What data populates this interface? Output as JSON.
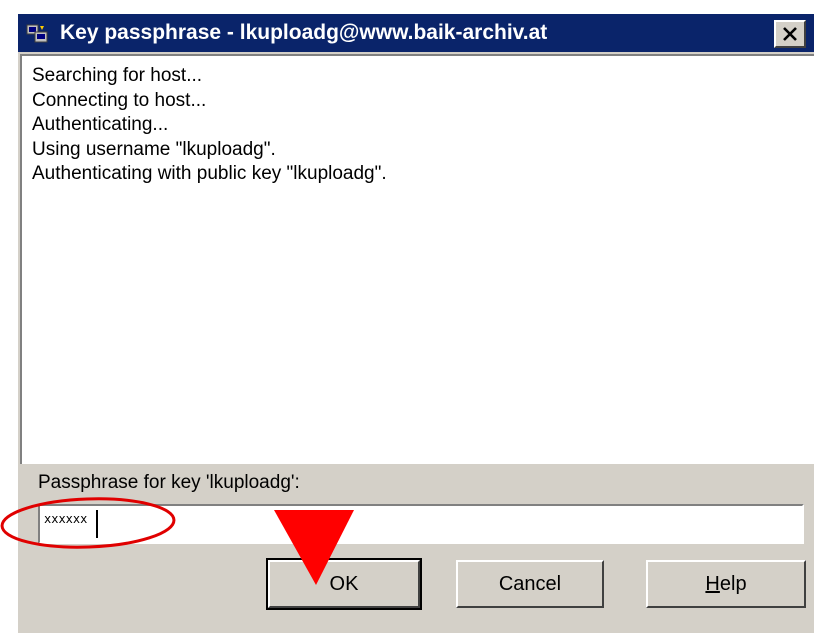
{
  "window": {
    "title": "Key passphrase - lkuploadg@www.baik-archiv.at",
    "close_label": "×"
  },
  "log": {
    "lines": [
      "Searching for host...",
      "Connecting to host...",
      "Authenticating...",
      "Using username \"lkuploadg\".",
      "Authenticating with public key \"lkuploadg\"."
    ]
  },
  "passphrase": {
    "label": "Passphrase for key 'lkuploadg':",
    "value": "xxxxxx"
  },
  "buttons": {
    "ok": "OK",
    "cancel": "Cancel",
    "help_first": "H",
    "help_rest": "elp"
  },
  "annotations": {
    "circle_color": "#e00000",
    "arrow_color": "#ff0000"
  },
  "colors": {
    "titlebar": "#0a246a",
    "dialog": "#d4d0c8"
  }
}
